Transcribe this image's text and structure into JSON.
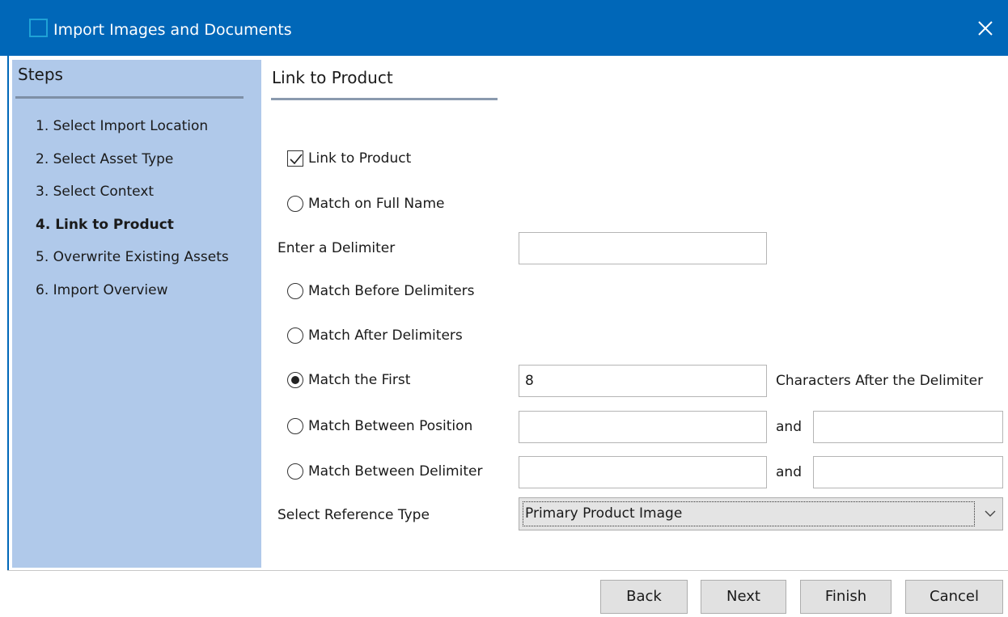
{
  "window": {
    "title": "Import Images and Documents"
  },
  "steps": {
    "title": "Steps",
    "items": [
      {
        "label": "1. Select Import Location",
        "active": false
      },
      {
        "label": "2. Select Asset Type",
        "active": false
      },
      {
        "label": "3. Select Context",
        "active": false
      },
      {
        "label": "4. Link to Product",
        "active": true
      },
      {
        "label": "5. Overwrite Existing Assets",
        "active": false
      },
      {
        "label": "6. Import Overview",
        "active": false
      }
    ]
  },
  "section": {
    "title": "Link to Product"
  },
  "form": {
    "link_to_product": {
      "label": "Link to Product",
      "checked": true
    },
    "match_full_name": {
      "label": "Match on Full Name",
      "selected": false
    },
    "delimiter": {
      "label": "Enter a Delimiter",
      "value": ""
    },
    "match_before": {
      "label": "Match Before Delimiters",
      "selected": false
    },
    "match_after": {
      "label": "Match After Delimiters",
      "selected": false
    },
    "match_first": {
      "label": "Match the First",
      "selected": true,
      "value": "8",
      "suffix": "Characters After the Delimiter"
    },
    "match_between_position": {
      "label": "Match Between Position",
      "selected": false,
      "from": "",
      "and_label": "and",
      "to": ""
    },
    "match_between_delimiter": {
      "label": "Match Between Delimiter",
      "selected": false,
      "from": "",
      "and_label": "and",
      "to": ""
    },
    "reference_type": {
      "label": "Select Reference Type",
      "value": "Primary Product Image"
    }
  },
  "buttons": {
    "back": "Back",
    "next": "Next",
    "finish": "Finish",
    "cancel": "Cancel"
  },
  "colors": {
    "titlebar": "#0067b8",
    "steps_panel": "#b0c9ea"
  }
}
